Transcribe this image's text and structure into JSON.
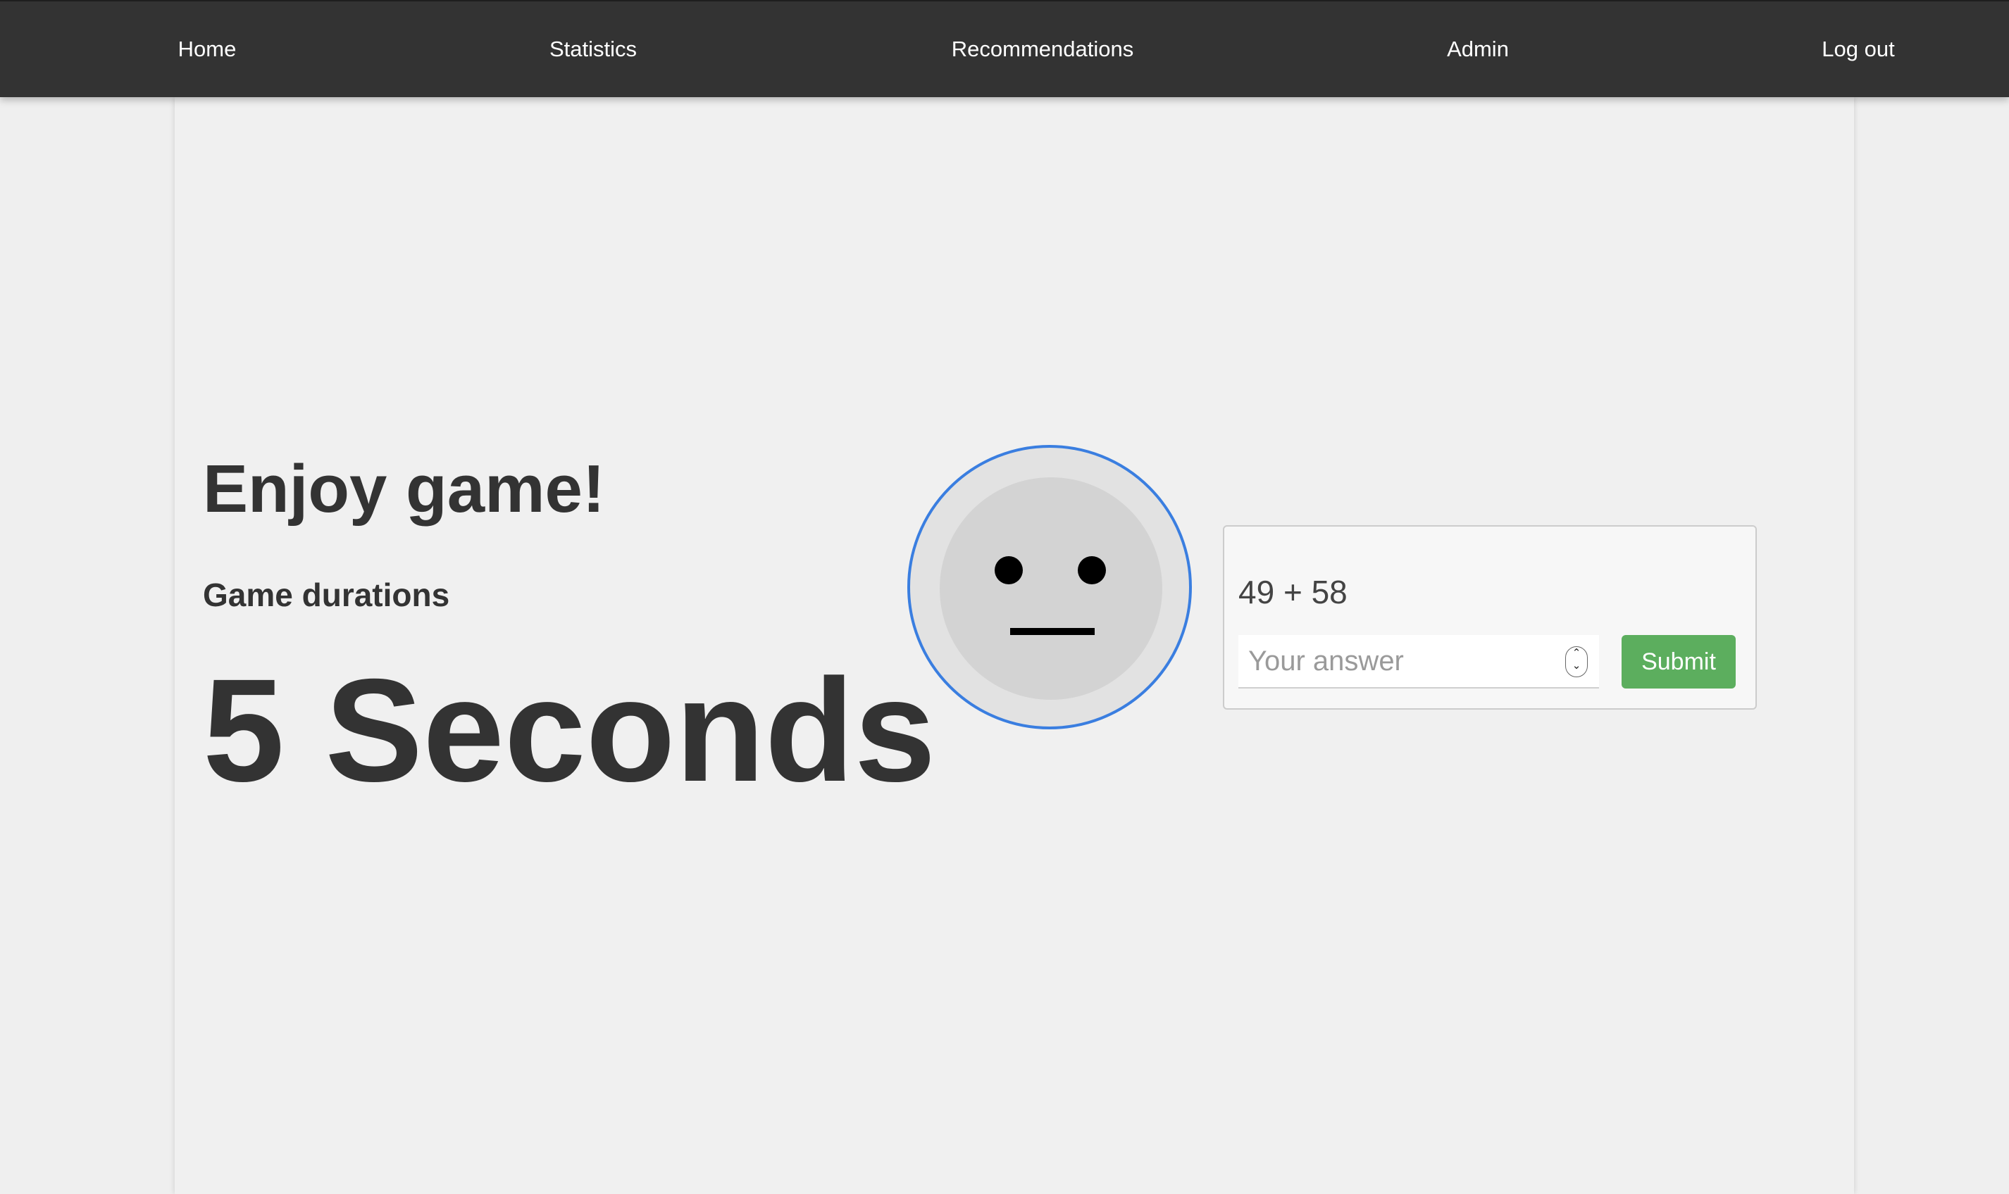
{
  "nav": {
    "items": [
      {
        "label": "Home"
      },
      {
        "label": "Statistics"
      },
      {
        "label": "Recommendations"
      },
      {
        "label": "Admin"
      },
      {
        "label": "Log out"
      }
    ]
  },
  "main": {
    "title": "Enjoy game!",
    "subtitle": "Game durations",
    "duration": "5 Seconds"
  },
  "face": {
    "expression": "neutral-face-icon"
  },
  "quiz": {
    "question": "49 + 58",
    "answer_placeholder": "Your answer",
    "answer_value": "",
    "submit_label": "Submit"
  },
  "colors": {
    "navbar": "#333333",
    "background": "#efefef",
    "submit": "#5cae5e",
    "face_ring": "#3a7ee0"
  }
}
